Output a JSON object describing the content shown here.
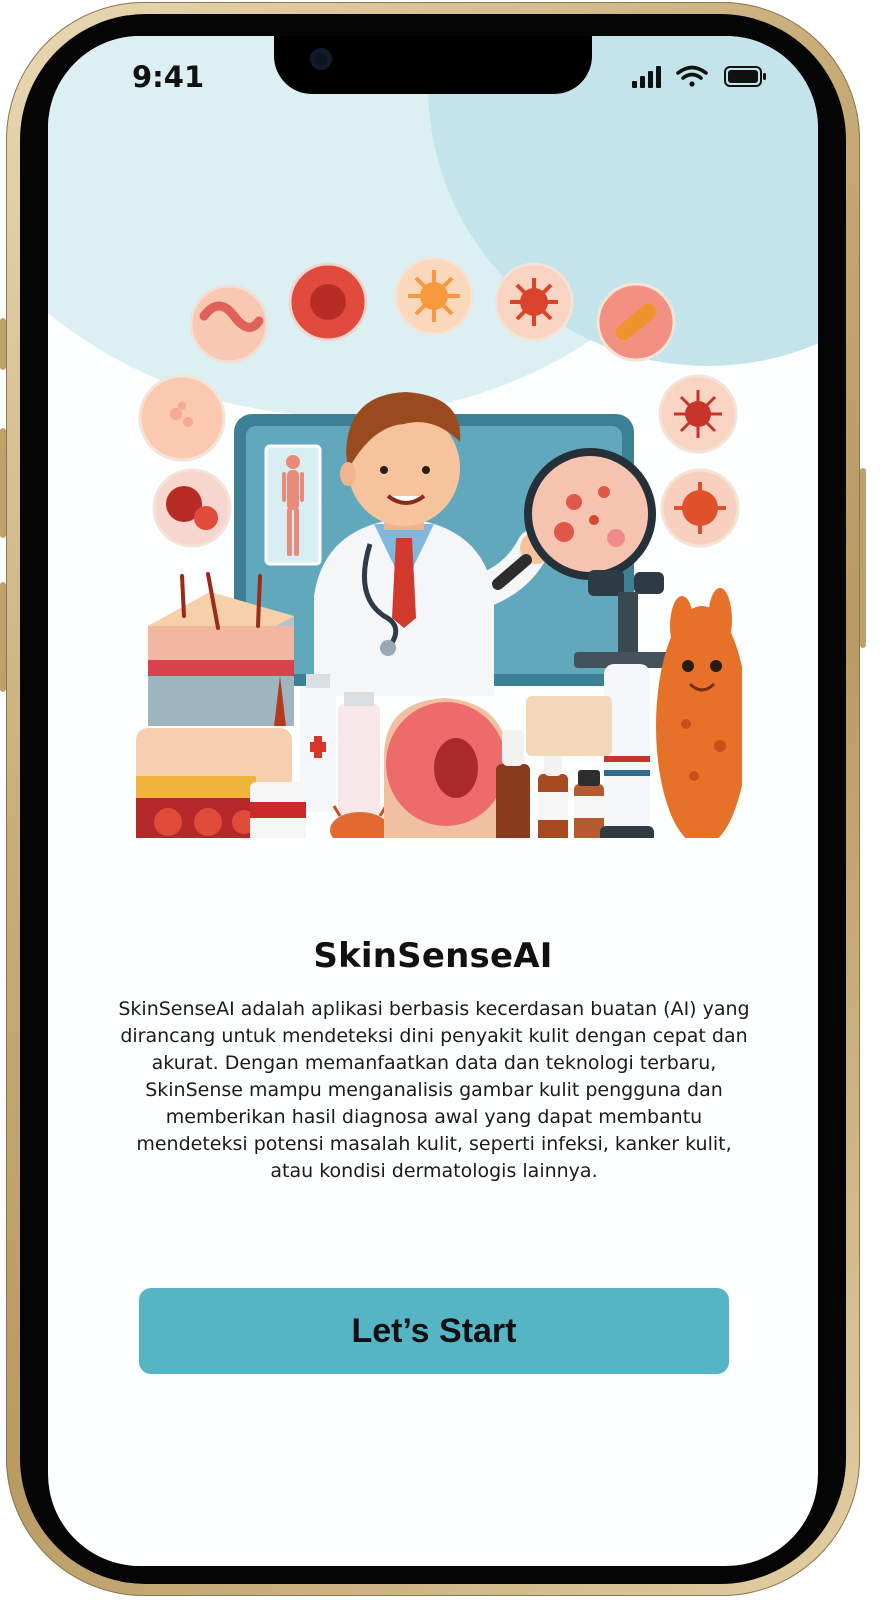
{
  "status_bar": {
    "time": "9:41",
    "icons": [
      "cellular-signal-icon",
      "wifi-icon",
      "battery-icon"
    ]
  },
  "onboarding": {
    "illustration": "dermatologist-with-magnifying-glass-illustration",
    "title": "SkinSenseAI",
    "description": "SkinSenseAI adalah aplikasi berbasis kecerdasan buatan (AI) yang dirancang untuk mendeteksi dini penyakit kulit dengan cepat dan akurat. Dengan memanfaatkan data dan teknologi terbaru, SkinSense mampu menganalisis gambar kulit pengguna dan memberikan hasil diagnosa awal yang dapat membantu mendeteksi potensi masalah kulit, seperti infeksi, kanker kulit, atau kondisi dermatologis lainnya.",
    "start_button_label": "Let’s Start"
  },
  "colors": {
    "accent": "#56b5c5",
    "background_blob_light": "#dcf0f4",
    "background_blob_dark": "#c2e4ea",
    "text": "#111111"
  }
}
